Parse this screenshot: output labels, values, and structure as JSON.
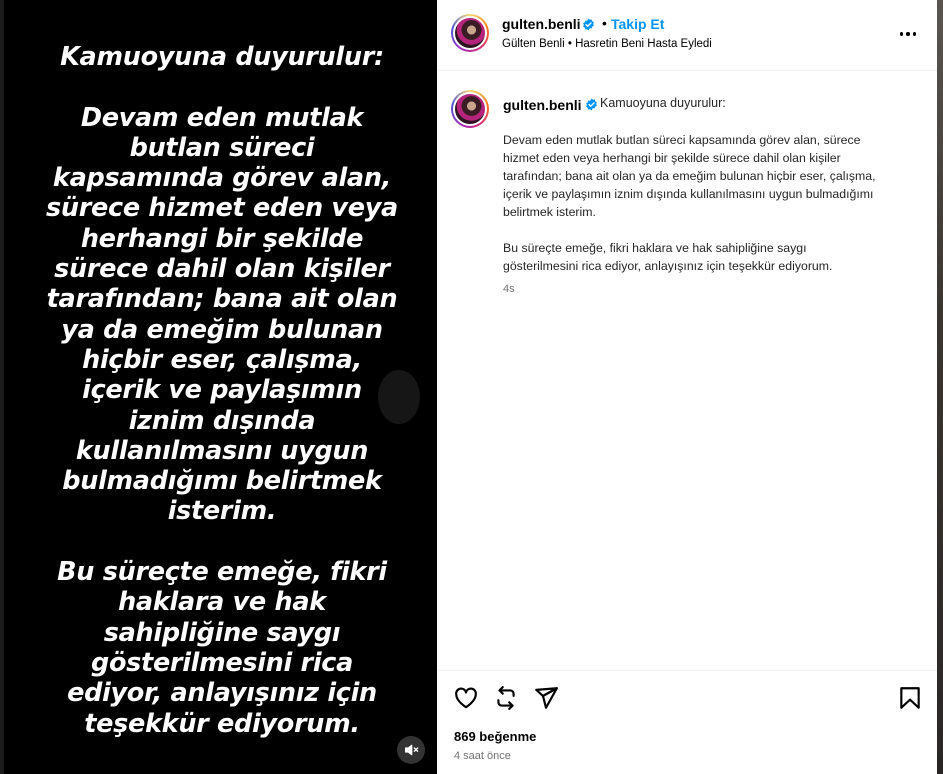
{
  "media": {
    "text": "Kamuoyuna duyurulur:\n\nDevam eden mutlak\nbutlan süreci\nkapsamında görev alan,\nsürece hizmet eden veya\nherhangi bir şekilde\nsürece dahil olan kişiler\ntarafından; bana ait olan\nya da emeğim bulunan\nhiçbir eser, çalışma,\niçerik ve paylaşımın\niznim dışında\nkullanılmasını uygun\nbulmadığımı belirtmek\nisterim.\n\nBu süreçte emeğe, fikri\nhaklara ve hak\nsahipliğine saygı\ngösterilmesini rica\nediyor, anlayışınız için\nteşekkür ediyorum.",
    "mute_icon": "speaker-muted-icon"
  },
  "header": {
    "username": "gulten.benli",
    "separator": "•",
    "follow_label": "Takip Et",
    "subline": "Gülten Benli • Hasretin Beni Hasta Eyledi",
    "more_icon": "more-horizontal-icon"
  },
  "caption": {
    "username": "gulten.benli",
    "first_line": "Kamuoyuna duyurulur:",
    "body": "Devam eden mutlak butlan süreci kapsamında görev alan, sürece\nhizmet eden veya herhangi bir şekilde sürece dahil olan kişiler\ntarafından; bana ait olan ya da emeğim bulunan hiçbir eser, çalışma,\niçerik ve paylaşımın iznim dışında kullanılmasını uygun bulmadığımı\nbelirtmek isterim.\n\nBu süreçte emeğe, fikri haklara ve hak sahipliğine saygı\ngösterilmesini rica ediyor, anlayışınız için teşekkür ediyorum.",
    "time": "4s"
  },
  "actions": {
    "icons": [
      "heart-icon",
      "repost-icon",
      "share-icon",
      "bookmark-icon"
    ],
    "likes": "869 beğenme",
    "time_ago": "4 saat önce"
  },
  "colors": {
    "follow": "#0095f6",
    "verified": "#0095f6",
    "muted_text": "#737373"
  }
}
